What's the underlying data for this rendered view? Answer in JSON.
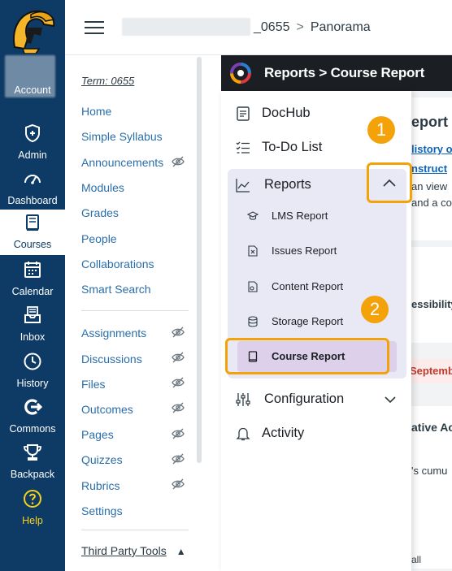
{
  "global_nav": {
    "items": [
      {
        "label": "Account",
        "icon": "user-icon"
      },
      {
        "label": "Admin",
        "icon": "shield-icon"
      },
      {
        "label": "Dashboard",
        "icon": "dashboard-icon"
      },
      {
        "label": "Courses",
        "icon": "book-icon"
      },
      {
        "label": "Calendar",
        "icon": "calendar-icon"
      },
      {
        "label": "Inbox",
        "icon": "inbox-icon"
      },
      {
        "label": "History",
        "icon": "clock-icon"
      },
      {
        "label": "Commons",
        "icon": "commons-icon"
      },
      {
        "label": "Backpack",
        "icon": "trophy-icon"
      },
      {
        "label": "Help",
        "icon": "help-icon"
      }
    ],
    "active": "Courses",
    "colors": {
      "bg": "#0e3a66",
      "help": "#f7d21a"
    }
  },
  "header": {
    "breadcrumb_course": "_0655",
    "breadcrumb_sep": ">",
    "breadcrumb_page": "Panorama"
  },
  "course_nav": {
    "term": "Term: 0655",
    "items": [
      {
        "label": "Home",
        "hidden": false
      },
      {
        "label": "Simple Syllabus",
        "hidden": false
      },
      {
        "label": "Announcements",
        "hidden": true
      },
      {
        "label": "Modules",
        "hidden": false
      },
      {
        "label": "Grades",
        "hidden": false
      },
      {
        "label": "People",
        "hidden": false
      },
      {
        "label": "Collaborations",
        "hidden": false
      },
      {
        "label": "Smart Search",
        "hidden": false
      }
    ],
    "items2": [
      {
        "label": "Assignments",
        "hidden": true
      },
      {
        "label": "Discussions",
        "hidden": true
      },
      {
        "label": "Files",
        "hidden": true
      },
      {
        "label": "Outcomes",
        "hidden": true
      },
      {
        "label": "Pages",
        "hidden": true
      },
      {
        "label": "Quizzes",
        "hidden": true
      },
      {
        "label": "Rubrics",
        "hidden": true
      },
      {
        "label": "Settings",
        "hidden": false
      }
    ],
    "third_party": "Third Party Tools"
  },
  "panorama": {
    "title": "Reports > Course Report",
    "background": {
      "heading": "eport",
      "link1": "listory o",
      "link2": "nstruct",
      "line1": "an view",
      "line2": "and a co",
      "line3": "essibility",
      "warn": "September",
      "line4": "ative Ac",
      "line5": "'s cumu",
      "line6": "all"
    },
    "menu": {
      "items": [
        {
          "label": "DocHub",
          "icon": "document-icon"
        },
        {
          "label": "To-Do List",
          "icon": "checklist-icon"
        },
        {
          "label": "Reports",
          "icon": "chart-line-icon"
        }
      ],
      "sub_items": [
        {
          "label": "LMS Report",
          "icon": "graduation-cap-icon"
        },
        {
          "label": "Issues Report",
          "icon": "issue-file-icon"
        },
        {
          "label": "Content Report",
          "icon": "content-file-icon"
        },
        {
          "label": "Storage Report",
          "icon": "database-icon"
        },
        {
          "label": "Course Report",
          "icon": "book-small-icon"
        }
      ],
      "bottom_items": [
        {
          "label": "Configuration",
          "icon": "sliders-icon"
        },
        {
          "label": "Activity",
          "icon": "bell-icon"
        }
      ]
    },
    "callouts": [
      "1",
      "2"
    ],
    "highlight_color": "#f4a20a"
  }
}
